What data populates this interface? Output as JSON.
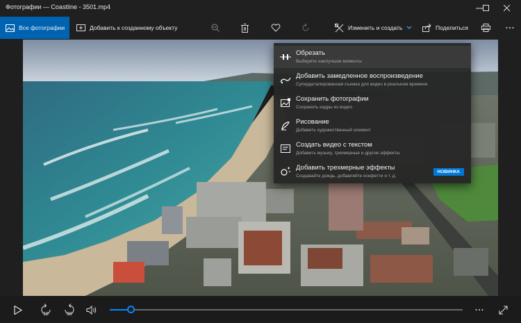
{
  "window": {
    "title": "Фотографии — Coastline - 3501.mp4"
  },
  "toolbar": {
    "all_photos_label": "Все фотографии",
    "add_to_object_label": "Добавить к созданному объекту",
    "edit_create_label": "Изменить и создать",
    "share_label": "Поделиться"
  },
  "menu": {
    "items": [
      {
        "title": "Обрезать",
        "subtitle": "Выберите наилучшие моменты",
        "icon": "trim-icon"
      },
      {
        "title": "Добавить замедленное воспроизведение",
        "subtitle": "Супердеталированная съемка для видео в реальном времени",
        "icon": "slow-motion-icon"
      },
      {
        "title": "Сохранить фотографии",
        "subtitle": "Сохранить кадры из видео",
        "icon": "save-photo-icon"
      },
      {
        "title": "Рисование",
        "subtitle": "Добавить художественный элемент",
        "icon": "draw-icon"
      },
      {
        "title": "Создать видео с текстом",
        "subtitle": "Добавить музыку, трехмерные и другие эффекты",
        "icon": "video-text-icon"
      },
      {
        "title": "Добавить трехмерные эффекты",
        "subtitle": "Создавайте дождь, добавляйте конфетти и т. д.",
        "icon": "3d-effects-icon",
        "badge": "НОВИНКА"
      }
    ]
  },
  "player": {
    "back_seconds": "10",
    "forward_seconds": "30",
    "progress": 0.06
  },
  "colors": {
    "accent": "#0063b1",
    "badge": "#0078d7",
    "progress": "#0a84ff"
  }
}
